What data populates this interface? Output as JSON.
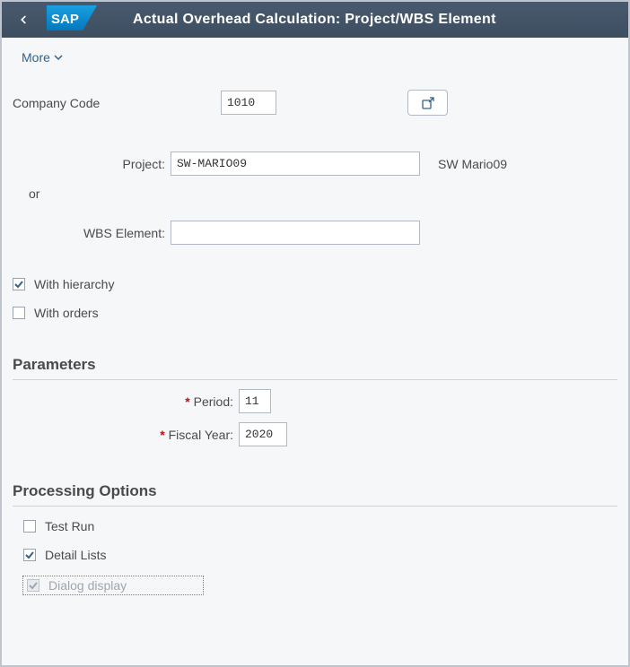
{
  "header": {
    "title": "Actual Overhead Calculation: Project/WBS Element"
  },
  "toolbar": {
    "more_label": "More"
  },
  "fields": {
    "company_code_label": "Company Code",
    "company_code_value": "1010",
    "project_label": "Project:",
    "project_value": "SW-MARIO09",
    "project_desc": "SW Mario09",
    "or_label": "or",
    "wbs_label": "WBS Element:",
    "wbs_value": ""
  },
  "checks": {
    "with_hierarchy_label": "With hierarchy",
    "with_orders_label": "With orders"
  },
  "parameters": {
    "section": "Parameters",
    "period_label": "Period:",
    "period_value": "11",
    "fiscal_year_label": "Fiscal Year:",
    "fiscal_year_value": "2020"
  },
  "processing": {
    "section": "Processing Options",
    "test_run_label": "Test Run",
    "detail_lists_label": "Detail Lists",
    "dialog_display_label": "Dialog display"
  }
}
